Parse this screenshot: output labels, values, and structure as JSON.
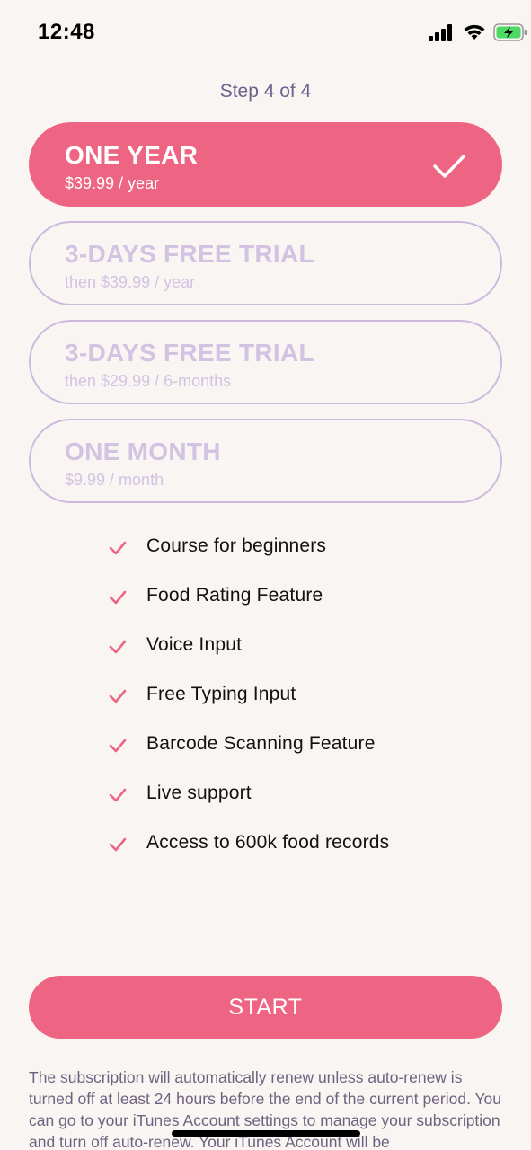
{
  "status_bar": {
    "time": "12:48",
    "signal_icon": "cellular-signal-icon",
    "wifi_icon": "wifi-icon",
    "battery_icon": "battery-charging-icon"
  },
  "step_label": "Step 4 of 4",
  "plans": [
    {
      "title": "ONE YEAR",
      "price": "$39.99 / year",
      "selected": true
    },
    {
      "title": "3-DAYS FREE TRIAL",
      "price": "then $39.99 / year",
      "selected": false
    },
    {
      "title": "3-DAYS FREE TRIAL",
      "price": "then $29.99 / 6-months",
      "selected": false
    },
    {
      "title": "ONE MONTH",
      "price": "$9.99 / month",
      "selected": false
    }
  ],
  "features": [
    "Course for beginners",
    "Food Rating Feature",
    "Voice Input",
    "Free Typing Input",
    "Barcode Scanning Feature",
    "Live support",
    "Access to 600k food records"
  ],
  "start_label": "START",
  "disclaimer": "The subscription will automatically renew unless auto-renew is turned off at least 24 hours before the end of the current period. You can go to your iTunes Account settings to manage your subscription and turn off auto-renew. Your iTunes Account will be",
  "colors": {
    "accent": "#ee6584",
    "unselected_border": "#cdb9dd",
    "unselected_text": "#d3c3e3",
    "step_text": "#6e5f8c",
    "background": "#f8f5f2"
  }
}
